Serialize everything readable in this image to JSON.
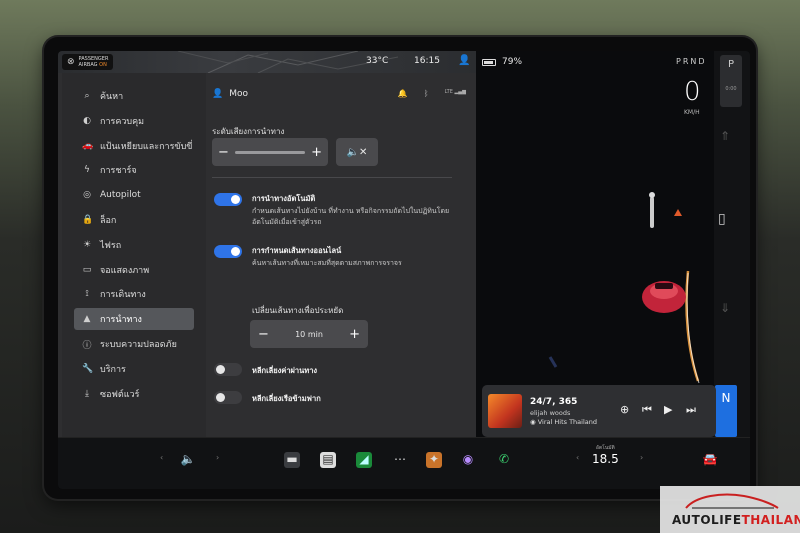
{
  "status": {
    "airbag_line1": "PASSENGER",
    "airbag_line2": "AIRBAG",
    "airbag_state": "ON",
    "temperature": "33°C",
    "time": "16:15",
    "battery": "79%",
    "gears": "PRND",
    "speed": "0",
    "speed_unit": "KM/H",
    "gear_p": "P",
    "gear_p_sub": "0:00",
    "gear_n": "N"
  },
  "sidebar": {
    "items": [
      {
        "label": "ค้นหา",
        "icon": "search-icon"
      },
      {
        "label": "การควบคุม",
        "icon": "toggle-icon"
      },
      {
        "label": "แป้นเหยียบและการขับขี่",
        "icon": "car-icon"
      },
      {
        "label": "การชาร์จ",
        "icon": "bolt-icon"
      },
      {
        "label": "Autopilot",
        "icon": "steering-icon"
      },
      {
        "label": "ล็อก",
        "icon": "lock-icon"
      },
      {
        "label": "ไฟรถ",
        "icon": "light-icon"
      },
      {
        "label": "จอแสดงภาพ",
        "icon": "display-icon"
      },
      {
        "label": "การเดินทาง",
        "icon": "trip-icon"
      },
      {
        "label": "การนำทาง",
        "icon": "navigation-icon"
      },
      {
        "label": "ระบบความปลอดภัย",
        "icon": "safety-icon"
      },
      {
        "label": "บริการ",
        "icon": "wrench-icon"
      },
      {
        "label": "ซอฟต์แวร์",
        "icon": "download-icon"
      }
    ],
    "active_index": 9
  },
  "content": {
    "profile_name": "Moo",
    "volume_label": "ระดับเสียงการนำทาง",
    "options": [
      {
        "title": "การนำทางอัตโนมัติ",
        "desc": "กำหนดเส้นทางไปยังบ้าน ที่ทำงาน หรือกิจกรรมถัดไปในปฏิทินโดยอัตโนมัติเมื่อเข้าสู่ตัวรถ",
        "on": true
      },
      {
        "title": "การกำหนดเส้นทางออนไลน์",
        "desc": "ค้นหาเส้นทางที่เหมาะสมที่สุดตามสภาพการจราจร",
        "on": true
      },
      {
        "title": "หลีกเลี่ยงค่าผ่านทาง",
        "on": false
      },
      {
        "title": "หลีกเลี่ยงเรือข้ามฟาก",
        "on": false
      }
    ],
    "reroute_label": "เปลี่ยนเส้นทางเพื่อประหยัด",
    "reroute_value": "10 min",
    "lte": "LTE"
  },
  "media": {
    "track": "24/7, 365",
    "artist": "elijah woods",
    "source": "Viral Hits Thailand"
  },
  "dock": {
    "cabin_temp_label": "อัตโนมัติ",
    "cabin_temp": "18.5"
  },
  "watermark": {
    "text_a": "AUTOLIFE",
    "text_b": "THAILAND.TV"
  }
}
